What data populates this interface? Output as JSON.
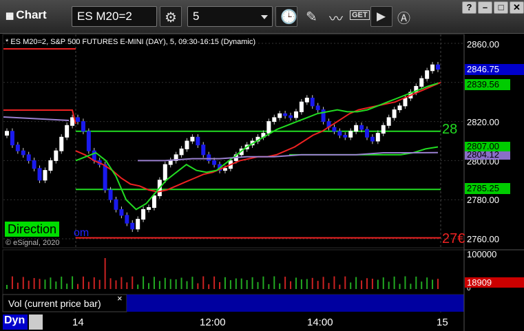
{
  "window": {
    "title": "Chart",
    "symbol": "ES M20=2",
    "interval": "5",
    "minimize": "?",
    "restore": "□",
    "close": "✕"
  },
  "chart": {
    "header": "* ES M20=2, S&P 500 FUTURES E-MINI (DAY), 5, 09:30-16:15 (Dynamic)",
    "copyright": "© eSignal, 2020",
    "direction_label": "Direction",
    "partial_label": "om",
    "overlay_label_upper": "28",
    "overlay_label_lower": "27€",
    "price_axis": [
      "2860.00",
      "2840.00",
      "2820.00",
      "2800.00",
      "2780.00",
      "2760.00"
    ],
    "price_flags": [
      {
        "label": "2846.75",
        "color": "#0000cc",
        "text_color": "#ffffff"
      },
      {
        "label": "2839.56",
        "color": "#00cc00",
        "text_color": "#000000"
      },
      {
        "label": "2807.00",
        "color": "#00cc00",
        "text_color": "#000000"
      },
      {
        "label": "2804.12",
        "color": "#8a6fc7",
        "text_color": "#000000"
      },
      {
        "label": "2785.25",
        "color": "#00cc00",
        "text_color": "#000000"
      }
    ],
    "vol_label": "Vol (current price bar)",
    "vol_axis": [
      "100000",
      "0"
    ],
    "vol_flag": "18909",
    "time_axis": [
      "14",
      "12:00",
      "14:00",
      "15"
    ],
    "dyn_label": "Dyn"
  },
  "colors": {
    "up": "#ffffff",
    "down": "#1a1aee",
    "green": "#22dd22",
    "red": "#ee2222",
    "purple": "#9a80d0"
  },
  "chart_data": {
    "type": "candlestick",
    "instrument": "ES M20=2",
    "interval_minutes": 5,
    "price_range": [
      2755,
      2865
    ],
    "horizontal_levels": [
      {
        "price": 2815,
        "color": "green"
      },
      {
        "price": 2785.25,
        "color": "green"
      },
      {
        "price": 2760.5,
        "color": "red"
      }
    ],
    "last_price": 2846.75,
    "volume_range": [
      0,
      100000
    ],
    "last_volume": 18909,
    "series": [
      {
        "color": "red",
        "values": [
          2805,
          2803,
          2800,
          2798,
          2795,
          2791,
          2788,
          2787,
          2785,
          2784,
          2785,
          2787,
          2789,
          2791,
          2793,
          2794,
          2796,
          2798,
          2800,
          2801,
          2802,
          2802,
          2803,
          2805,
          2807,
          2810,
          2813,
          2815,
          2818,
          2821,
          2824,
          2826,
          2827,
          2828,
          2829,
          2830,
          2832,
          2834,
          2836,
          2838,
          2840
        ]
      },
      {
        "color": "green",
        "values": [
          2800,
          2802,
          2804,
          2800,
          2792,
          2780,
          2775,
          2778,
          2784,
          2790,
          2794,
          2798,
          2795,
          2794,
          2795,
          2799,
          2803,
          2807,
          2810,
          2813,
          2816,
          2818,
          2820,
          2822,
          2824,
          2825,
          2826,
          2825,
          2825,
          2826,
          2828,
          2830,
          2832,
          2834,
          2836,
          2838,
          2839.56
        ]
      },
      {
        "color": "green",
        "values": [
          2803,
          2803,
          2803,
          2803,
          2803,
          2803,
          2803,
          2803,
          2803,
          2803,
          2804,
          2806,
          2807
        ]
      },
      {
        "color": "purple",
        "values": [
          2800,
          2800,
          2801,
          2801,
          2802,
          2802,
          2803,
          2803,
          2803,
          2804,
          2804,
          2804.12
        ]
      }
    ]
  }
}
